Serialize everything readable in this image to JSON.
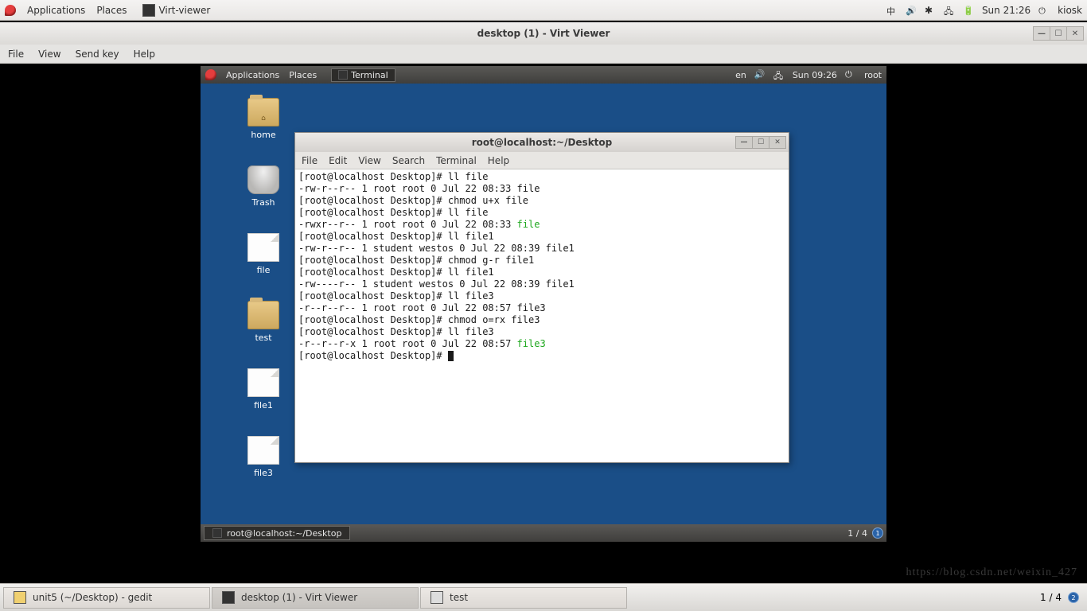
{
  "outer_panel": {
    "applications": "Applications",
    "places": "Places",
    "app_task": "Virt-viewer",
    "time": "Sun 21:26",
    "user": "kiosk"
  },
  "vv": {
    "title": "desktop (1) - Virt Viewer",
    "menu": {
      "file": "File",
      "view": "View",
      "sendkey": "Send key",
      "help": "Help"
    }
  },
  "guest_panel": {
    "applications": "Applications",
    "places": "Places",
    "app_task": "Terminal",
    "lang": "en",
    "time": "Sun 09:26",
    "user": "root"
  },
  "desktop_icons": {
    "home": "home",
    "trash": "Trash",
    "file": "file",
    "test": "test",
    "file1": "file1",
    "file3": "file3"
  },
  "terminal": {
    "title": "root@localhost:~/Desktop",
    "menu": {
      "file": "File",
      "edit": "Edit",
      "view": "View",
      "search": "Search",
      "terminal": "Terminal",
      "help": "Help"
    },
    "lines": [
      {
        "t": "[root@localhost Desktop]# ll file"
      },
      {
        "t": "-rw-r--r-- 1 root root 0 Jul 22 08:33 file"
      },
      {
        "t": "[root@localhost Desktop]# chmod u+x file"
      },
      {
        "t": "[root@localhost Desktop]# ll file"
      },
      {
        "t": "-rwxr--r-- 1 root root 0 Jul 22 08:33 ",
        "g": "file"
      },
      {
        "t": "[root@localhost Desktop]# ll file1"
      },
      {
        "t": "-rw-r--r-- 1 student westos 0 Jul 22 08:39 file1"
      },
      {
        "t": "[root@localhost Desktop]# chmod g-r file1"
      },
      {
        "t": "[root@localhost Desktop]# ll file1"
      },
      {
        "t": "-rw----r-- 1 student westos 0 Jul 22 08:39 file1"
      },
      {
        "t": "[root@localhost Desktop]# ll file3"
      },
      {
        "t": "-r--r--r-- 1 root root 0 Jul 22 08:57 file3"
      },
      {
        "t": "[root@localhost Desktop]# chmod o=rx file3"
      },
      {
        "t": "[root@localhost Desktop]# ll file3"
      },
      {
        "t": "-r--r--r-x 1 root root 0 Jul 22 08:57 ",
        "g": "file3"
      },
      {
        "t": "[root@localhost Desktop]# ",
        "cursor": true
      }
    ]
  },
  "guest_taskbar": {
    "task": "root@localhost:~/Desktop",
    "ws": "1 / 4"
  },
  "outer_taskbar": {
    "t1": "unit5 (~/Desktop) - gedit",
    "t2": "desktop (1) - Virt Viewer",
    "t3": "test",
    "ws": "1 / 4"
  },
  "watermark": "https://blog.csdn.net/weixin_427"
}
